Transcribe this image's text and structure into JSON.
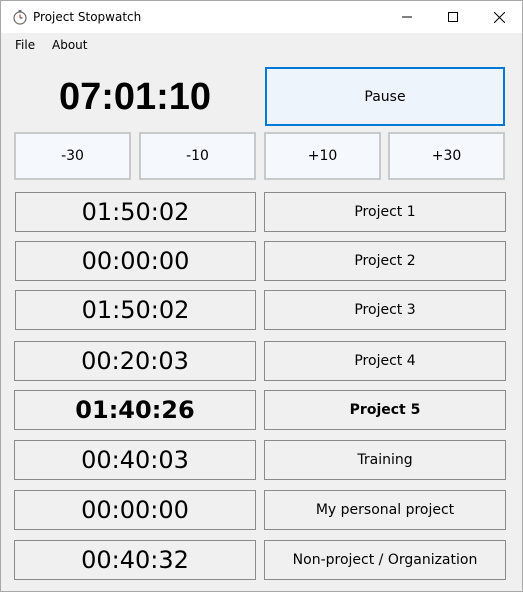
{
  "window": {
    "title": "Project Stopwatch",
    "icon": "stopwatch-icon",
    "controls": [
      "minimize-icon",
      "maximize-icon",
      "close-icon"
    ]
  },
  "menu": {
    "file": "File",
    "about": "About"
  },
  "main_timer": "07:01:10",
  "pause_label": "Pause",
  "adjust_buttons": [
    "-30",
    "-10",
    "+10",
    "+30"
  ],
  "projects": [
    {
      "time": "01:50:02",
      "name": "Project 1",
      "active": false
    },
    {
      "time": "00:00:00",
      "name": "Project 2",
      "active": false
    },
    {
      "time": "01:50:02",
      "name": "Project 3",
      "active": false
    },
    {
      "time": "00:20:03",
      "name": "Project 4",
      "active": false
    },
    {
      "time": "01:40:26",
      "name": "Project 5",
      "active": true
    },
    {
      "time": "00:40:03",
      "name": "Training",
      "active": false
    },
    {
      "time": "00:00:00",
      "name": "My personal project",
      "active": false
    },
    {
      "time": "00:40:32",
      "name": "Non-project / Organization",
      "active": false
    }
  ],
  "colors": {
    "accent": "#0078d7",
    "background": "#f0f0f0",
    "titlebar": "#ffffff"
  }
}
